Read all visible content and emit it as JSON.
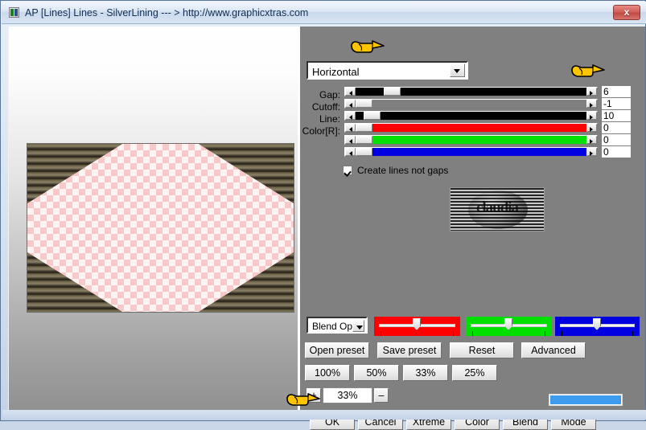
{
  "window": {
    "title": "AP [Lines]  Lines - SilverLining   --- > http://www.graphicxtras.com",
    "close_label": "x",
    "icon": "plugin-icon"
  },
  "preview": {
    "thumbnail_word": "claudia",
    "canvas_description": "checkerboard-transparency-octagon"
  },
  "controls": {
    "type_combo": {
      "value": "Horizontal",
      "arrow": "chevron-down-icon"
    },
    "sliders": [
      {
        "label": "Gap:",
        "value": "6",
        "track_color": "#000000",
        "thumb_pct": 9
      },
      {
        "label": "Cutoff:",
        "value": "-1",
        "track_color": "#808080",
        "thumb_pct": 0
      },
      {
        "label": "Line:",
        "value": "10",
        "track_color": "#000000",
        "thumb_pct": 3
      },
      {
        "label": "Color[R]:",
        "value": "0",
        "track_color": "#ff0000",
        "thumb_pct": 0
      },
      {
        "label": "",
        "value": "0",
        "track_color": "#00e000",
        "thumb_pct": 0
      },
      {
        "label": "",
        "value": "0",
        "track_color": "#0000e0",
        "thumb_pct": 0
      }
    ],
    "checkbox": {
      "label": "Create lines not gaps",
      "checked": true
    }
  },
  "blend": {
    "combo_value": "Blend Opti",
    "trackbars": [
      {
        "name": "red",
        "color": "#ff0000",
        "position_pct": 50
      },
      {
        "name": "green",
        "color": "#00e000",
        "position_pct": 50
      },
      {
        "name": "blue",
        "color": "#0000e0",
        "position_pct": 50
      }
    ]
  },
  "preset_buttons": [
    {
      "label": "Open preset"
    },
    {
      "label": "Save preset"
    },
    {
      "label": "Reset"
    },
    {
      "label": "Advanced"
    }
  ],
  "zoom_buttons": [
    {
      "label": "100%"
    },
    {
      "label": "50%"
    },
    {
      "label": "33%"
    },
    {
      "label": "25%"
    }
  ],
  "zoom_stepper": {
    "plus_label": "+",
    "value": "33%",
    "minus_label": "–"
  },
  "progress": {
    "percent": 100,
    "color": "#3d9bf0"
  },
  "action_buttons": [
    {
      "label": "OK"
    },
    {
      "label": "Cancel"
    },
    {
      "label": "Xtreme"
    },
    {
      "label": "Color"
    },
    {
      "label": "Blend"
    },
    {
      "label": "Mode"
    }
  ]
}
